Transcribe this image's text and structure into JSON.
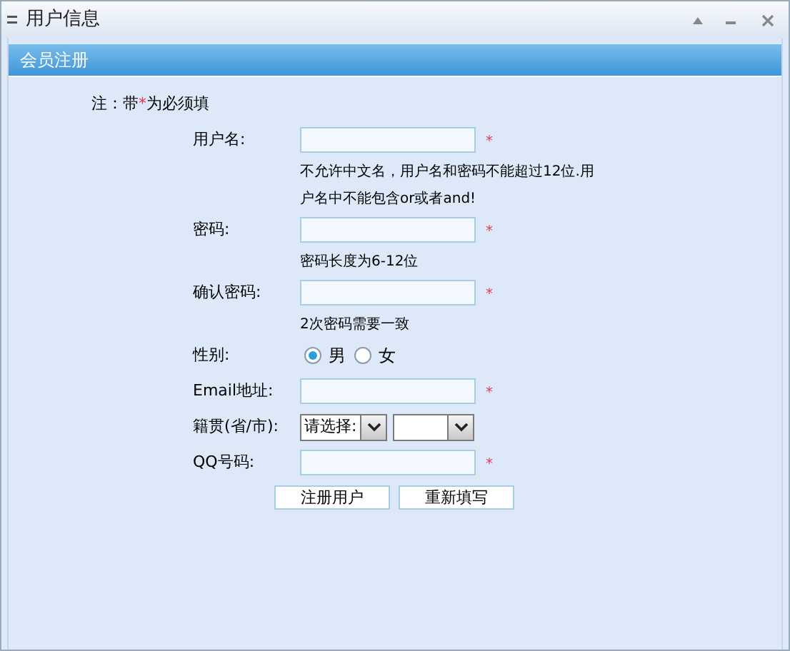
{
  "window": {
    "title": "用户信息"
  },
  "section": {
    "title": "会员注册"
  },
  "note": {
    "prefix": "注：带",
    "mark": "*",
    "suffix": "为必须填"
  },
  "fields": [
    {
      "kind": "text",
      "label": "用户名:",
      "required": true,
      "hint": [
        "不允许中文名，用户名和密码不能超过12位.用",
        "户名中不能包含or或者and!"
      ]
    },
    {
      "kind": "text",
      "label": "密码:",
      "required": true,
      "hint": [
        "密码长度为6-12位"
      ]
    },
    {
      "kind": "text",
      "label": "确认密码:",
      "required": true,
      "hint": [
        "2次密码需要一致"
      ]
    },
    {
      "kind": "radio",
      "label": "性别:",
      "options": [
        {
          "label": "男",
          "selected": true
        },
        {
          "label": "女",
          "selected": false
        }
      ]
    },
    {
      "kind": "text",
      "label": "Email地址:",
      "required": true
    },
    {
      "kind": "select",
      "label": "籍贯(省/市):",
      "selects": [
        {
          "kind": "dropdown",
          "value": "请选择:"
        },
        {
          "kind": "dropdown"
        }
      ]
    },
    {
      "kind": "text",
      "label": "QQ号码:",
      "required": true
    }
  ],
  "buttons": [
    "注册用户",
    "重新填写"
  ]
}
